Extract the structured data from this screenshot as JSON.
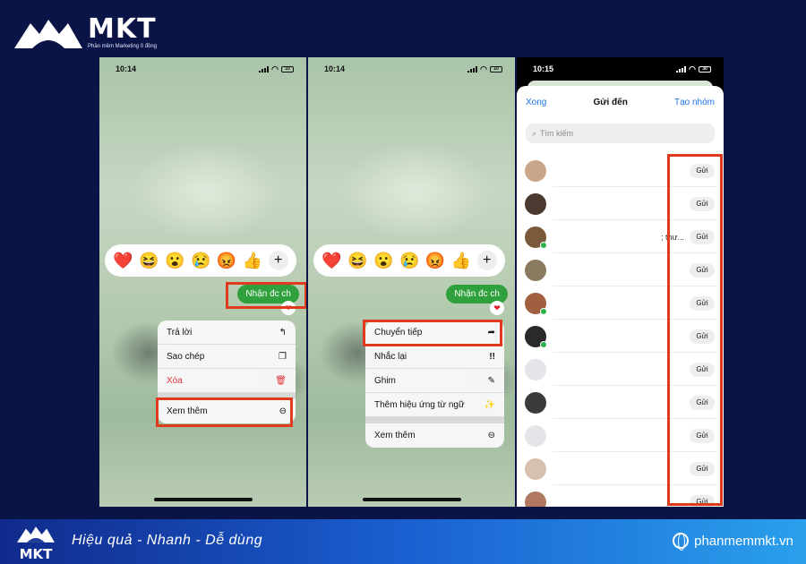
{
  "brand": {
    "name": "MKT",
    "tagline": "Phần mềm Marketing 0 đồng",
    "footer_slogan": "Hiệu quả - Nhanh  - Dễ dùng",
    "website": "phanmemmkt.vn"
  },
  "colors": {
    "background": "#0b1446",
    "highlight_box": "#e03a1e",
    "bubble_green": "#2fa03c",
    "link_blue": "#1a73e8",
    "danger_red": "#e0303a"
  },
  "phone1": {
    "time": "10:14",
    "battery": "10",
    "reactions": [
      "❤️",
      "😆",
      "😮",
      "😢",
      "😡",
      "👍"
    ],
    "reaction_more": "+",
    "bubble_text": "Nhận đc ch",
    "menu": [
      {
        "label": "Trả lời",
        "icon": "reply-icon",
        "glyph": "↰"
      },
      {
        "label": "Sao chép",
        "icon": "copy-icon",
        "glyph": "❐"
      },
      {
        "label": "Xóa",
        "icon": "trash-icon",
        "glyph": "🗑"
      }
    ],
    "more": {
      "label": "Xem thêm",
      "icon": "more-circle-icon",
      "glyph": "⊖"
    }
  },
  "phone2": {
    "time": "10:14",
    "battery": "10",
    "reactions": [
      "❤️",
      "😆",
      "😮",
      "😢",
      "😡",
      "👍"
    ],
    "reaction_more": "+",
    "bubble_text": "Nhận đc ch",
    "menu": [
      {
        "label": "Chuyển tiếp",
        "icon": "forward-icon",
        "glyph": "➦"
      },
      {
        "label": "Nhắc lại",
        "icon": "remind-icon",
        "glyph": "!!"
      },
      {
        "label": "Ghim",
        "icon": "pin-icon",
        "glyph": "✎"
      },
      {
        "label": "Thêm hiệu ứng từ ngữ",
        "icon": "effects-icon",
        "glyph": "✨"
      }
    ],
    "more": {
      "label": "Xem thêm",
      "icon": "more-circle-icon",
      "glyph": "⊖"
    }
  },
  "phone3": {
    "time": "10:15",
    "battery": "30",
    "sheet": {
      "done": "Xong",
      "title": "Gửi đến",
      "create_group": "Tạo nhóm",
      "search_placeholder": "Tìm kiếm"
    },
    "send_label": "Gửi",
    "contacts": [
      {
        "avatar": "#c9a58a",
        "online": false,
        "snippet": ""
      },
      {
        "avatar": "#4a3a30",
        "online": false,
        "snippet": ""
      },
      {
        "avatar": "#7a5a3a",
        "online": true,
        "snippet": "; thư..."
      },
      {
        "avatar": "#8a7a60",
        "online": false,
        "snippet": ""
      },
      {
        "avatar": "#a06040",
        "online": true,
        "snippet": ""
      },
      {
        "avatar": "#2a2a2a",
        "online": true,
        "snippet": ""
      },
      {
        "avatar": "#e3e5e8",
        "online": false,
        "snippet": ""
      },
      {
        "avatar": "#3a3a3a",
        "online": false,
        "snippet": ""
      },
      {
        "avatar": "#e3e5e8",
        "online": false,
        "snippet": ""
      },
      {
        "avatar": "#d8c0b0",
        "online": false,
        "snippet": ""
      },
      {
        "avatar": "#b07860",
        "online": false,
        "snippet": "."
      }
    ]
  }
}
